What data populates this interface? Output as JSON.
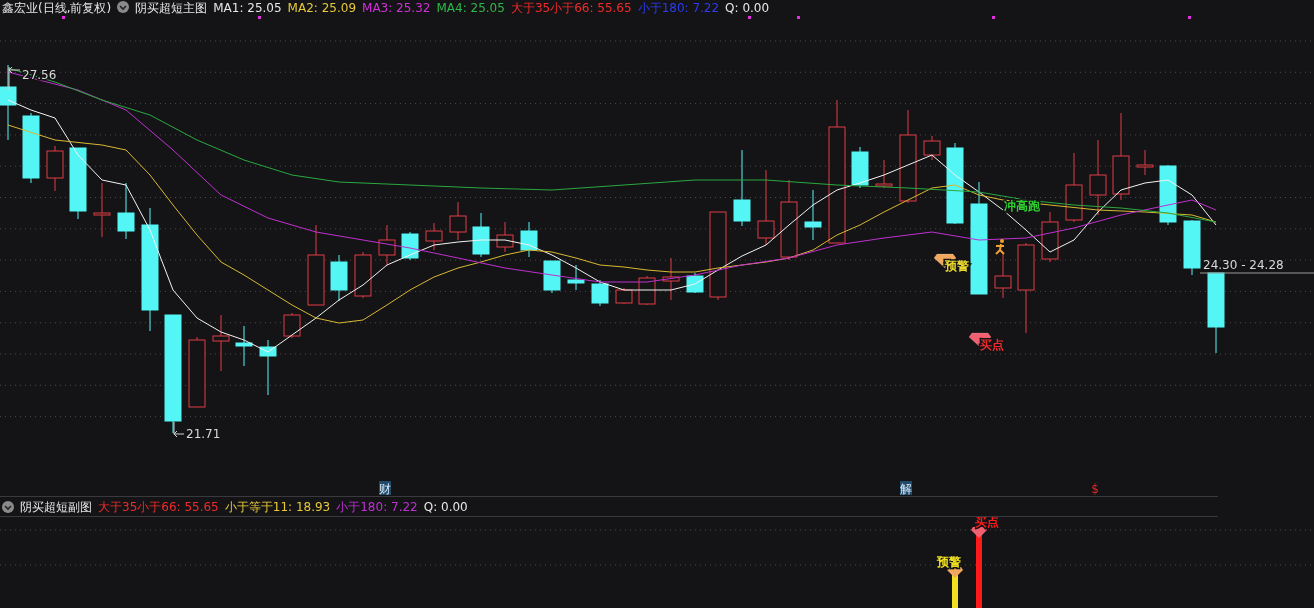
{
  "header": {
    "title": "鑫宏业(日线,前复权)",
    "indicator": "阴买超短主图",
    "readings": [
      {
        "label": "MA1: 25.05",
        "color": "#e6e6e6"
      },
      {
        "label": "MA2: 25.09",
        "color": "#e8c93a"
      },
      {
        "label": "MA3: 25.32",
        "color": "#d030d8"
      },
      {
        "label": "MA4: 25.05",
        "color": "#2fb84a"
      },
      {
        "label": "大于35小于66: 55.65",
        "color": "#f02a2a"
      },
      {
        "label": "小于180: 7.22",
        "color": "#2a3cf0"
      },
      {
        "label": "Q: 0.00",
        "color": "#e6e6e6"
      }
    ]
  },
  "price_chart": {
    "high_label": "27.56",
    "low_label": "21.71",
    "last_price": "24.30 - 24.28",
    "signals": [
      {
        "kind": "text",
        "label": "冲高跑",
        "color": "#2fd02f"
      },
      {
        "kind": "gem",
        "label": "预警",
        "color": "#e8d830"
      },
      {
        "kind": "runner",
        "color": "#f0a030"
      },
      {
        "kind": "gem",
        "label": "买点",
        "color": "#f02a2a"
      }
    ]
  },
  "event_markers": [
    {
      "label": "财",
      "kind": "highlight"
    },
    {
      "label": "解",
      "kind": "highlight"
    },
    {
      "label": "$",
      "kind": "plain"
    }
  ],
  "sub_chart": {
    "title": "阴买超短副图",
    "readings": [
      {
        "label": "大于35小于66: 55.65",
        "color": "#f02a2a"
      },
      {
        "label": "小于等于11: 18.93",
        "color": "#e8c93a"
      },
      {
        "label": "小于180: 7.22",
        "color": "#c030d8"
      },
      {
        "label": "Q: 0.00",
        "color": "#e6e6e6"
      }
    ],
    "signals": [
      {
        "label": "预警",
        "color": "#f0e020"
      },
      {
        "label": "买点",
        "color": "#ff1a1a"
      }
    ]
  }
}
